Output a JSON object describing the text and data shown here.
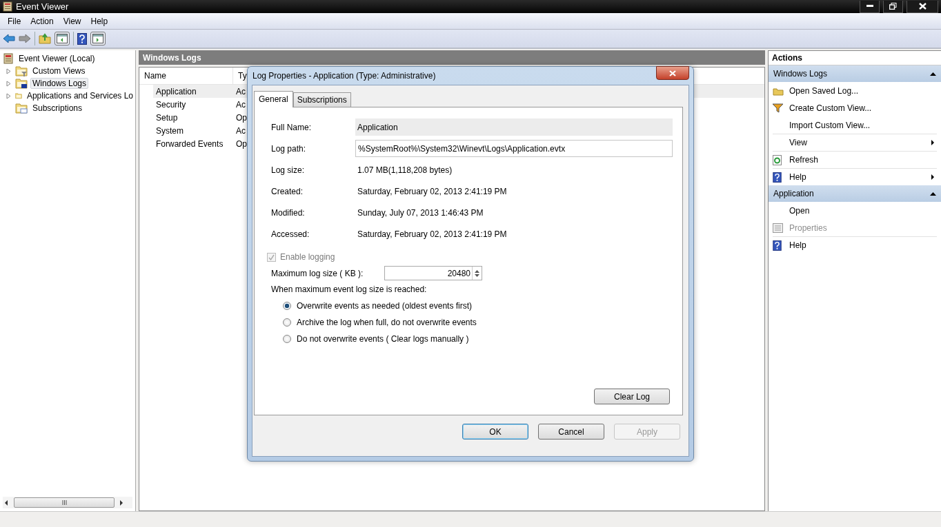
{
  "window": {
    "title": "Event Viewer"
  },
  "menu": [
    "File",
    "Action",
    "View",
    "Help"
  ],
  "toolbar": [
    {
      "kind": "back"
    },
    {
      "kind": "forward"
    },
    {
      "kind": "sep"
    },
    {
      "kind": "up"
    },
    {
      "kind": "tree"
    },
    {
      "kind": "sep"
    },
    {
      "kind": "help"
    },
    {
      "kind": "pane"
    }
  ],
  "tree": {
    "label": "Event Viewer (Local)",
    "expanded": true,
    "selected": false,
    "children": [
      {
        "label": "Custom Views",
        "expanded": false,
        "selected": false,
        "kind": "filter"
      },
      {
        "label": "Windows Logs",
        "expanded": false,
        "selected": true,
        "kind": "logs"
      },
      {
        "label": "Applications and Services Lo",
        "expanded": false,
        "selected": false,
        "kind": "plain"
      },
      {
        "label": "Subscriptions",
        "selected": false,
        "kind": "subscriptions"
      }
    ]
  },
  "center": {
    "title": "Windows Logs",
    "columns": [
      "Name",
      "Ty"
    ],
    "rows": [
      {
        "name": "Application",
        "type": "Ac",
        "selected": true
      },
      {
        "name": "Security",
        "type": "Ac",
        "selected": false
      },
      {
        "name": "Setup",
        "type": "Op",
        "selected": false
      },
      {
        "name": "System",
        "type": "Ac",
        "selected": false
      },
      {
        "name": "Forwarded Events",
        "type": "Op",
        "selected": false
      }
    ]
  },
  "dialog": {
    "title": "Log Properties - Application (Type: Administrative)",
    "tabs": [
      {
        "label": "General",
        "selected": true
      },
      {
        "label": "Subscriptions",
        "selected": false
      }
    ],
    "fields": [
      {
        "label": "Full Name:",
        "value": "Application",
        "kind": "readonly"
      },
      {
        "label": "Log path:",
        "value": "%SystemRoot%\\System32\\Winevt\\Logs\\Application.evtx",
        "kind": "input"
      },
      {
        "label": "Log size:",
        "value": "1.07 MB(1,118,208 bytes)",
        "kind": "text"
      },
      {
        "label": "Created:",
        "value": "Saturday, February 02, 2013 2:41:19 PM",
        "kind": "text"
      },
      {
        "label": "Modified:",
        "value": "Sunday, July 07, 2013 1:46:43 PM",
        "kind": "text"
      },
      {
        "label": "Accessed:",
        "value": "Saturday, February 02, 2013 2:41:19 PM",
        "kind": "text"
      }
    ],
    "enable_logging": {
      "label": "Enable logging",
      "checked": true,
      "disabled": true
    },
    "max_size": {
      "label": "Maximum log size ( KB ):",
      "value": "20480"
    },
    "policy_label": "When maximum event log size is reached:",
    "policies": [
      {
        "label": "Overwrite events as needed (oldest events first)",
        "selected": true
      },
      {
        "label": "Archive the log when full, do not overwrite events",
        "selected": false
      },
      {
        "label": "Do not overwrite events ( Clear logs manually )",
        "selected": false
      }
    ],
    "clear_button": "Clear Log",
    "buttons": [
      {
        "label": "OK",
        "disabled": false,
        "default": true
      },
      {
        "label": "Cancel",
        "disabled": false,
        "default": false
      },
      {
        "label": "Apply",
        "disabled": true,
        "default": false
      }
    ]
  },
  "actions": {
    "title": "Actions",
    "sections": [
      {
        "title": "Windows Logs",
        "expanded": true,
        "items": [
          {
            "label": "Open Saved Log...",
            "kind": "open",
            "submenu": false,
            "disabled": false,
            "divider": false
          },
          {
            "label": "Create Custom View...",
            "kind": "filter",
            "submenu": false,
            "disabled": false,
            "divider": false
          },
          {
            "label": "Import Custom View...",
            "kind": "text",
            "submenu": false,
            "disabled": false,
            "divider": false
          },
          {
            "label": "View",
            "kind": "text",
            "submenu": true,
            "disabled": false,
            "divider": true
          },
          {
            "label": "Refresh",
            "kind": "refresh",
            "submenu": false,
            "disabled": false,
            "divider": true
          },
          {
            "label": "Help",
            "kind": "help",
            "submenu": true,
            "disabled": false,
            "divider": true
          }
        ]
      },
      {
        "title": "Application",
        "expanded": true,
        "items": [
          {
            "label": "Open",
            "kind": "text",
            "submenu": false,
            "disabled": false,
            "divider": false
          },
          {
            "label": "Properties",
            "kind": "properties",
            "submenu": false,
            "disabled": true,
            "divider": false
          },
          {
            "label": "Help",
            "kind": "help",
            "submenu": false,
            "disabled": false,
            "divider": true
          }
        ]
      }
    ]
  }
}
